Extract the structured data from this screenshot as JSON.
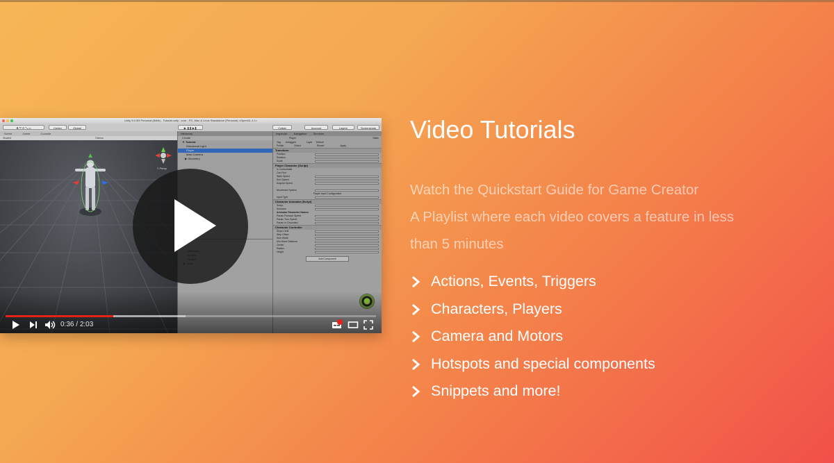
{
  "video": {
    "unity_title": "Unity 5.6.0f3 Personal (64bit) - Tutorial.unity - core - PC, Mac & Linux Standalone (Personal) <OpenGL 4.1>",
    "toolbar": {
      "center_label": "Center",
      "global_label": "Global",
      "collab_label": "Collab",
      "account_label": "Account",
      "layers_label": "Layers",
      "layout_label": "Screenshots"
    },
    "scene_tabs": [
      "Scene",
      "Game",
      "Console"
    ],
    "scene_shading": "Shaded",
    "scene_gizmos": "Gizmos",
    "persp_label": "≡ Persp",
    "hierarchy": {
      "tab_label": "Hierarchy",
      "create_label": "Create",
      "rows": [
        "▼ Tutorial",
        "Directional Light",
        "Player",
        "Main Camera",
        "▶ Geometry"
      ]
    },
    "project_rows": [
      "Materials",
      "Scripts",
      "Plugins",
      "▶ Temp"
    ],
    "inspector": {
      "tabs": [
        "Inspector",
        "Navigation",
        "Services"
      ],
      "object_name": "Player",
      "static_label": "Static",
      "tag_label": "Tag",
      "tag_value": "Untagged",
      "layer_label": "Layer",
      "layer_value": "Default",
      "prefab_label": "Prefab",
      "prefab_buttons": [
        "Select",
        "Revert",
        "Apply"
      ],
      "sections": [
        {
          "title": "Transform",
          "rows": [
            "Position",
            "Rotation",
            "Scale"
          ]
        },
        {
          "title": "Player Character (Script)",
          "rows": [
            "Is Controllable",
            "Can Run",
            "Walk Speed",
            "Run Speed",
            "Angular Speed",
            "",
            "Movement System",
            "Player Input Configuration",
            "Input Type"
          ]
        },
        {
          "title": "Character Animator (Script)",
          "rows": [
            "Script",
            "Animator",
            "Animator Parameter Names",
            "Param Forward Speed",
            "Param Turn Speed",
            "Param Is Grounded"
          ]
        },
        {
          "title": "Character Controller",
          "rows": [
            "Slope Limit",
            "Step Offset",
            "Skin Width",
            "Min Move Distance",
            "Center",
            "Radius",
            "Height"
          ]
        }
      ],
      "add_component_label": "Add Component"
    },
    "time_current": "0:36",
    "time_separator": " / ",
    "time_total": "2:03",
    "progress_played": 0.29,
    "progress_buffered": 0.485,
    "icons": [
      "play-icon",
      "next-icon",
      "volume-icon",
      "subtitles-icon",
      "theater-icon",
      "fullscreen-icon"
    ],
    "accent_color": "#e62117"
  },
  "heading": "Video Tutorials",
  "description_lines": [
    "Watch the Quickstart Guide for Game Creator",
    "A Playlist where each video covers a feature in less",
    "than 5 minutes"
  ],
  "features": [
    "Actions, Events, Triggers",
    "Characters, Players",
    "Camera and Motors",
    "Hotspots and special components",
    "Snippets and more!"
  ],
  "colors": {
    "gradient_start": "#f6b656",
    "gradient_end": "#f2504a",
    "text": "#ffffff"
  }
}
